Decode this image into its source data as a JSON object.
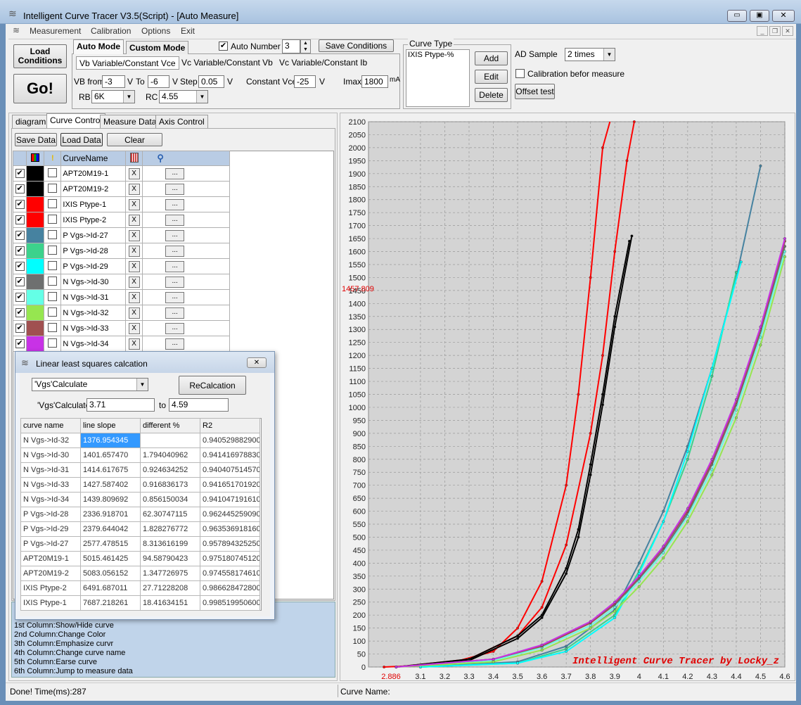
{
  "window": {
    "title": "Intelligent Curve Tracer V3.5(Script) - [Auto Measure]"
  },
  "menu": [
    "Measurement",
    "Calibration",
    "Options",
    "Exit"
  ],
  "toolbar": {
    "load_conditions": "Load Conditions",
    "go": "Go!",
    "tab_auto": "Auto Mode",
    "tab_custom": "Custom Mode",
    "auto_number_label": "Auto Number",
    "auto_number_value": "3",
    "save_conditions": "Save Conditions",
    "subtab_1": "Vb Variable/Constant Vce",
    "subtab_2": "Vc Variable/Constant Vb",
    "subtab_3": "Vc Variable/Constant Ib",
    "vb_from_label": "VB from",
    "vb_from_value": "-3",
    "v_unit": "V",
    "to_label": "To",
    "to_value": "-6",
    "step_label": "Step",
    "step_value": "0.05",
    "const_vce_label": "Constant Vce",
    "const_vce_value": "-25",
    "imax_label": "Imax",
    "imax_value": "1800",
    "ma_unit": "mA",
    "rb_label": "RB",
    "rb_value": "6K",
    "rc_label": "RC",
    "rc_value": "4.55",
    "curve_type_label": "Curve Type",
    "curve_type_value": "IXIS Ptype-%",
    "add": "Add",
    "edit": "Edit",
    "delete": "Delete",
    "ad_sample_label": "AD Sample",
    "ad_sample_value": "2 times",
    "calibration_label": "Calibration befor measure",
    "offset_test": "Offset test"
  },
  "left_tabs": [
    "diagram",
    "Curve Control",
    "Measure Data",
    "Axis Control"
  ],
  "curve_control": {
    "save_data": "Save Data",
    "load_data": "Load Data",
    "clear": "Clear",
    "header_name": "CurveName",
    "erase_label": "X",
    "jump_label": "...",
    "curves": [
      {
        "name": "APT20M19-1",
        "color": "#000000"
      },
      {
        "name": "APT20M19-2",
        "color": "#000000"
      },
      {
        "name": "IXIS Ptype-1",
        "color": "#ff0000"
      },
      {
        "name": "IXIS Ptype-2",
        "color": "#ff0000"
      },
      {
        "name": "P Vgs->Id-27",
        "color": "#4682a0"
      },
      {
        "name": "P Vgs->Id-28",
        "color": "#3cd28c"
      },
      {
        "name": "P Vgs->Id-29",
        "color": "#00ffff"
      },
      {
        "name": "N Vgs->Id-30",
        "color": "#6e7070"
      },
      {
        "name": "N Vgs->Id-31",
        "color": "#64ffe6"
      },
      {
        "name": "N Vgs->Id-32",
        "color": "#96e650"
      },
      {
        "name": "N Vgs->Id-33",
        "color": "#a05050"
      },
      {
        "name": "N Vgs->Id-34",
        "color": "#c832e6"
      }
    ]
  },
  "lls_dialog": {
    "title": "Linear least squares calcation",
    "select_value": "'Vgs'Calculate",
    "recalc": "ReCalcation",
    "range_label": "'Vgs'Calculate",
    "from_value": "3.71",
    "to_label": "to",
    "to_value": "4.59",
    "columns": [
      "curve name",
      "line slope",
      "different %",
      "R2"
    ],
    "rows": [
      [
        "N Vgs->Id-32",
        "1376.954345",
        "",
        "0.940529882900"
      ],
      [
        "N Vgs->Id-30",
        "1401.657470",
        "1.794040962",
        "0.941416978830"
      ],
      [
        "N Vgs->Id-31",
        "1414.617675",
        "0.924634252",
        "0.940407514570"
      ],
      [
        "N Vgs->Id-33",
        "1427.587402",
        "0.916836173",
        "0.941651701920"
      ],
      [
        "N Vgs->Id-34",
        "1439.809692",
        "0.856150034",
        "0.941047191610"
      ],
      [
        "P Vgs->Id-28",
        "2336.918701",
        "62.30747115",
        "0.962445259090"
      ],
      [
        "P Vgs->Id-29",
        "2379.644042",
        "1.828276772",
        "0.963536918160"
      ],
      [
        "P Vgs->Id-27",
        "2577.478515",
        "8.313616199",
        "0.957894325250"
      ],
      [
        "APT20M19-1",
        "5015.461425",
        "94.58790423",
        "0.975180745120"
      ],
      [
        "APT20M19-2",
        "5083.056152",
        "1.347726975",
        "0.974558174610"
      ],
      [
        "IXIS Ptype-2",
        "6491.687011",
        "27.71228208",
        "0.986628472800"
      ],
      [
        "IXIS Ptype-1",
        "7687.218261",
        "18.41634151",
        "0.998519950600"
      ]
    ]
  },
  "help_lines": [
    "1st Column:Show/Hide curve",
    "2nd Column:Change Color",
    "3th Column:Emphasize curvr",
    "4th Column:Change curve name",
    "5th Column:Earse curve",
    "6th Column:Jump to measure data"
  ],
  "status": {
    "left": "Done!  Time(ms):287",
    "right": "Curve Name:"
  },
  "chart_data": {
    "type": "line",
    "watermark": "Intelligent Curve Tracer by Locky_z",
    "cursor_y_label": "1457.809",
    "cursor_x_label": "2.886",
    "xlim": [
      2.886,
      4.6
    ],
    "ylim": [
      0,
      2100
    ],
    "x_ticks": [
      3.1,
      3.2,
      3.3,
      3.4,
      3.5,
      3.6,
      3.7,
      3.8,
      3.9,
      4,
      4.1,
      4.2,
      4.3,
      4.4,
      4.5,
      4.6
    ],
    "y_ticks": [
      0,
      50,
      100,
      150,
      200,
      250,
      300,
      350,
      400,
      450,
      500,
      550,
      600,
      650,
      700,
      750,
      800,
      850,
      900,
      950,
      1000,
      1050,
      1100,
      1150,
      1200,
      1250,
      1300,
      1350,
      1400,
      1450,
      1500,
      1550,
      1600,
      1650,
      1700,
      1750,
      1800,
      1850,
      1900,
      1950,
      2000,
      2050,
      2100
    ],
    "grid": true,
    "series": [
      {
        "name": "IXIS Ptype-1",
        "color": "#ff0000",
        "x": [
          2.95,
          3.2,
          3.4,
          3.5,
          3.6,
          3.7,
          3.75,
          3.8,
          3.85,
          3.88
        ],
        "y": [
          0,
          10,
          60,
          150,
          330,
          700,
          1050,
          1500,
          2000,
          2320
        ]
      },
      {
        "name": "IXIS Ptype-2",
        "color": "#ff0000",
        "x": [
          3.0,
          3.3,
          3.5,
          3.6,
          3.7,
          3.8,
          3.85,
          3.9,
          3.95,
          3.98
        ],
        "y": [
          0,
          30,
          120,
          230,
          470,
          900,
          1200,
          1600,
          1950,
          2100
        ]
      },
      {
        "name": "APT20M19-1",
        "color": "#000000",
        "x": [
          3.0,
          3.3,
          3.5,
          3.6,
          3.7,
          3.75,
          3.8,
          3.85,
          3.9,
          3.96
        ],
        "y": [
          0,
          30,
          120,
          200,
          380,
          530,
          780,
          1050,
          1350,
          1640
        ]
      },
      {
        "name": "APT20M19-2",
        "color": "#000000",
        "x": [
          3.0,
          3.3,
          3.5,
          3.6,
          3.7,
          3.75,
          3.8,
          3.85,
          3.9,
          3.97
        ],
        "y": [
          0,
          25,
          110,
          190,
          360,
          500,
          740,
          1010,
          1310,
          1660
        ]
      },
      {
        "name": "P Vgs->Id-27",
        "color": "#4682a0",
        "x": [
          3.1,
          3.5,
          3.7,
          3.9,
          4.0,
          4.1,
          4.2,
          4.3,
          4.4,
          4.5
        ],
        "y": [
          0,
          20,
          80,
          220,
          400,
          600,
          850,
          1150,
          1500,
          1930
        ]
      },
      {
        "name": "P Vgs->Id-28",
        "color": "#3cd28c",
        "x": [
          3.1,
          3.5,
          3.7,
          3.9,
          4.0,
          4.1,
          4.2,
          4.3,
          4.4
        ],
        "y": [
          0,
          15,
          70,
          200,
          370,
          560,
          800,
          1120,
          1520
        ]
      },
      {
        "name": "P Vgs->Id-29",
        "color": "#00ffff",
        "x": [
          3.1,
          3.5,
          3.7,
          3.9,
          4.0,
          4.1,
          4.2,
          4.3,
          4.42
        ],
        "y": [
          0,
          15,
          60,
          190,
          360,
          560,
          830,
          1150,
          1560
        ]
      },
      {
        "name": "N Vgs->Id-30",
        "color": "#6e7070",
        "x": [
          3.0,
          3.4,
          3.6,
          3.8,
          3.9,
          4.0,
          4.1,
          4.2,
          4.3,
          4.4,
          4.5,
          4.6
        ],
        "y": [
          0,
          30,
          80,
          170,
          240,
          340,
          450,
          590,
          780,
          1010,
          1290,
          1620
        ]
      },
      {
        "name": "N Vgs->Id-31",
        "color": "#64ffe6",
        "x": [
          3.0,
          3.4,
          3.6,
          3.8,
          3.9,
          4.0,
          4.1,
          4.2,
          4.3,
          4.4,
          4.5,
          4.6
        ],
        "y": [
          0,
          25,
          75,
          160,
          230,
          330,
          440,
          580,
          760,
          990,
          1270,
          1600
        ]
      },
      {
        "name": "N Vgs->Id-32",
        "color": "#96e650",
        "x": [
          3.0,
          3.4,
          3.6,
          3.8,
          3.9,
          4.0,
          4.1,
          4.2,
          4.3,
          4.4,
          4.5,
          4.6
        ],
        "y": [
          0,
          20,
          65,
          150,
          215,
          310,
          420,
          560,
          740,
          960,
          1240,
          1580
        ]
      },
      {
        "name": "N Vgs->Id-33",
        "color": "#a05050",
        "x": [
          3.0,
          3.4,
          3.6,
          3.8,
          3.9,
          4.0,
          4.1,
          4.2,
          4.3,
          4.4,
          4.5,
          4.6
        ],
        "y": [
          0,
          30,
          80,
          170,
          245,
          345,
          460,
          600,
          790,
          1020,
          1300,
          1640
        ]
      },
      {
        "name": "N Vgs->Id-34",
        "color": "#c832e6",
        "x": [
          3.0,
          3.4,
          3.6,
          3.8,
          3.9,
          4.0,
          4.1,
          4.2,
          4.3,
          4.4,
          4.5,
          4.6
        ],
        "y": [
          0,
          30,
          85,
          175,
          250,
          350,
          465,
          610,
          800,
          1030,
          1310,
          1650
        ]
      }
    ]
  }
}
